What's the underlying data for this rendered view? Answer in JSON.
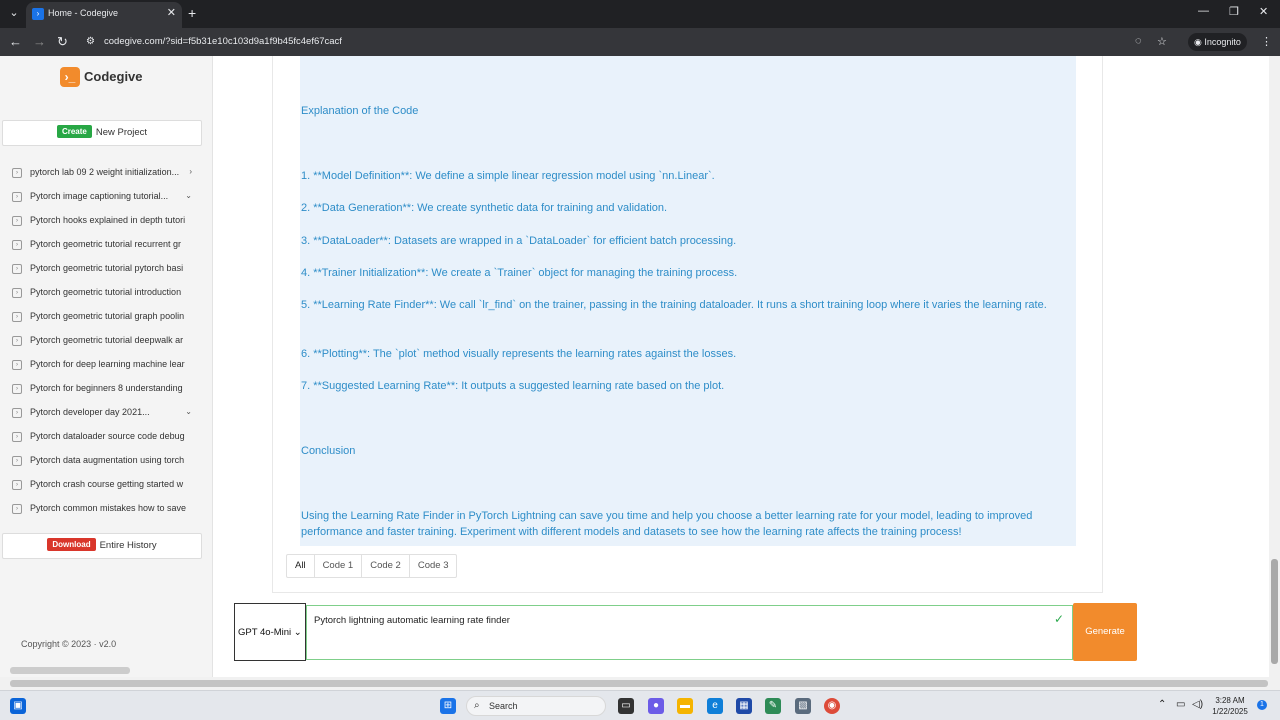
{
  "browser": {
    "tab_title": "Home - Codegive",
    "tab_close": "✕",
    "new_tab": "+",
    "url": "codegive.com/?sid=f5b31e10c103d9a1f9b45fc4ef67cacf",
    "incognito_label": "Incognito"
  },
  "sidebar": {
    "logo_text": "Codegive",
    "create_badge": "Create",
    "new_project_label": "New Project",
    "history": [
      {
        "label": "pytorch lab 09 2 weight initialization...",
        "chevron": "›"
      },
      {
        "label": "Pytorch image captioning tutorial...",
        "chevron": "⌄"
      },
      {
        "label": "Pytorch hooks explained in depth tutori",
        "chevron": ""
      },
      {
        "label": "Pytorch geometric tutorial recurrent gr",
        "chevron": ""
      },
      {
        "label": "Pytorch geometric tutorial pytorch basi",
        "chevron": ""
      },
      {
        "label": "Pytorch geometric tutorial introduction",
        "chevron": ""
      },
      {
        "label": "Pytorch geometric tutorial graph poolin",
        "chevron": ""
      },
      {
        "label": "Pytorch geometric tutorial deepwalk ar",
        "chevron": ""
      },
      {
        "label": "Pytorch for deep learning machine lear",
        "chevron": ""
      },
      {
        "label": "Pytorch for beginners 8 understanding",
        "chevron": ""
      },
      {
        "label": "Pytorch developer day 2021...",
        "chevron": "⌄"
      },
      {
        "label": "Pytorch dataloader source code debug",
        "chevron": ""
      },
      {
        "label": "Pytorch data augmentation using torch",
        "chevron": ""
      },
      {
        "label": "Pytorch crash course getting started w",
        "chevron": ""
      },
      {
        "label": "Pytorch common mistakes how to save",
        "chevron": ""
      }
    ],
    "download_badge": "Download",
    "entire_history_label": "Entire History",
    "copyright": "Copyright © 2023  ·  v2.0"
  },
  "answer": {
    "heading_explanation": "Explanation of the Code",
    "steps": [
      "1. **Model Definition**: We define a simple linear regression model using `nn.Linear`.",
      "2. **Data Generation**: We create synthetic data for training and validation.",
      "3. **DataLoader**: Datasets are wrapped in a `DataLoader` for efficient batch processing.",
      "4. **Trainer Initialization**: We create a `Trainer` object for managing the training process.",
      "5. **Learning Rate Finder**: We call `lr_find` on the trainer, passing in the training dataloader. It runs a short training loop where it varies the learning rate.",
      "6. **Plotting**: The `plot` method visually represents the learning rates against the losses.",
      "7. **Suggested Learning Rate**: It outputs a suggested learning rate based on the plot."
    ],
    "heading_conclusion": "Conclusion",
    "conclusion": "Using the Learning Rate Finder in PyTorch Lightning can save you time and help you choose a better learning rate for your model, leading to improved performance and faster training. Experiment with different models and datasets to see how the learning rate affects the training process!"
  },
  "code_tabs": [
    "All",
    "Code 1",
    "Code 2",
    "Code 3"
  ],
  "prompt": {
    "model": "GPT 4o-Mini",
    "text": "Pytorch lightning automatic learning rate finder",
    "generate_label": "Generate"
  },
  "taskbar": {
    "search_label": "Search",
    "time": "3:28 AM",
    "date": "1/22/2025",
    "notification_count": "1"
  },
  "colors": {
    "accent_orange": "#f28b2c",
    "answer_text": "#2e8dc8",
    "answer_bg": "#e9f2fb",
    "create_green": "#28a745",
    "download_red": "#d9362b"
  }
}
